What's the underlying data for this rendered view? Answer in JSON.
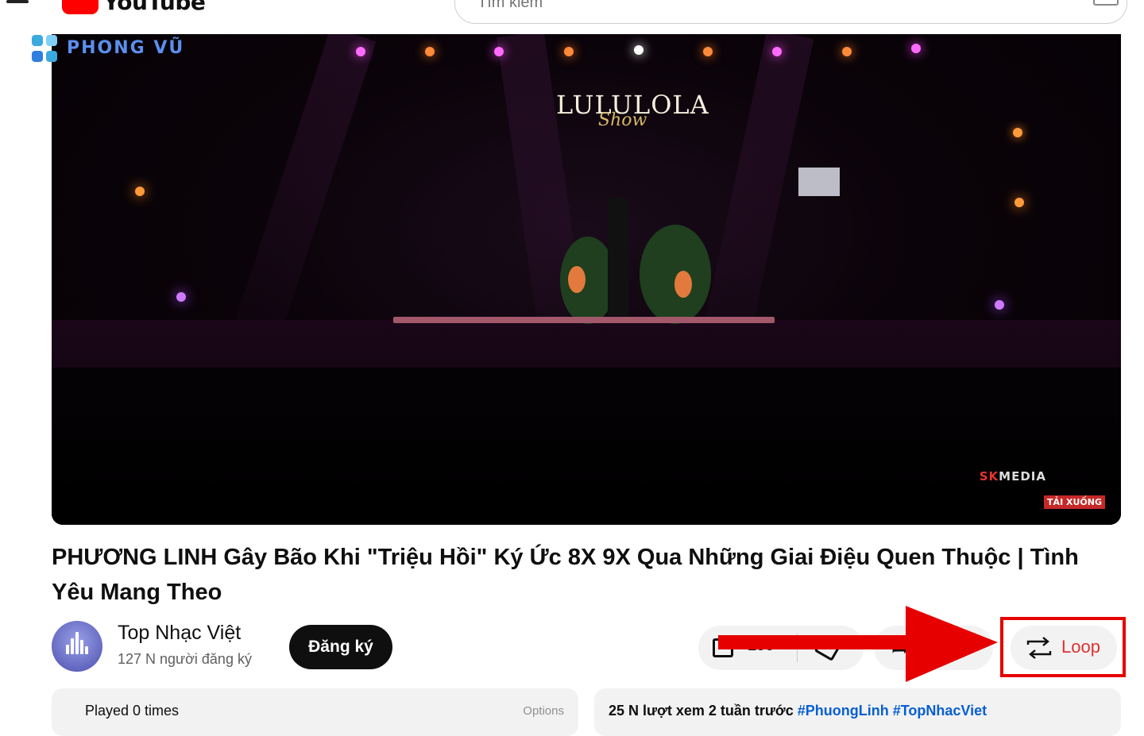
{
  "header": {
    "logo_text": "YouTube",
    "search_placeholder": "Tìm kiếm"
  },
  "watermark": {
    "text": "PHONG VŨ"
  },
  "player": {
    "stage_title": "LULULOLA",
    "stage_script": "Show",
    "producer_logo_red": "SK",
    "producer_logo": "MEDIA",
    "download_badge": "TẢI XUỐNG"
  },
  "video": {
    "title": "PHƯƠNG LINH Gây Bão Khi \"Triệu Hồi\" Ký Ức 8X 9X Qua Những Giai Điệu Quen Thuộc | Tình Yêu Mang Theo"
  },
  "channel": {
    "name": "Top Nhạc Việt",
    "subscribers": "127 N người đăng ký",
    "subscribe_label": "Đăng ký"
  },
  "actions": {
    "like_count": "150",
    "share_label": "Chia sẻ",
    "loop_label": "Loop"
  },
  "loop_panel": {
    "played_text": "Played 0 times",
    "options_text": "Options"
  },
  "description": {
    "stats": "25 N lượt xem  2 tuần trước",
    "hashtags": "#PhuongLinh #TopNhacViet"
  },
  "colors": {
    "youtube_red": "#ff0000",
    "loop_accent": "#e03131",
    "annotation_red": "#e60000",
    "link_blue": "#065fd4"
  },
  "icons": [
    "menu-icon",
    "youtube-logo-icon",
    "keyboard-icon",
    "thumbs-up-icon",
    "thumbs-down-icon",
    "share-icon",
    "loop-icon",
    "arrow-annotation"
  ]
}
